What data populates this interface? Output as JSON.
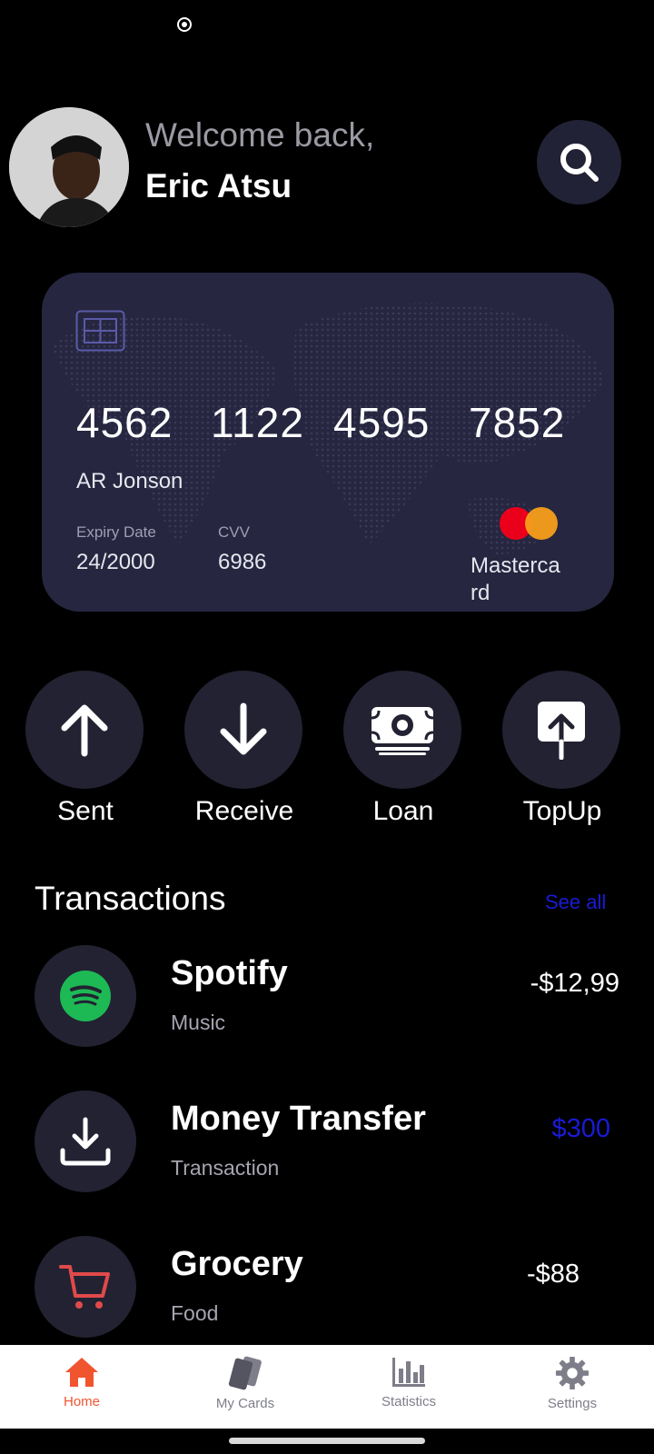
{
  "header": {
    "welcome": "Welcome back,",
    "username": "Eric Atsu"
  },
  "card": {
    "number_groups": [
      "4562",
      "1122",
      "4595",
      "7852"
    ],
    "holder": "AR Jonson",
    "expiry_label": "Expiry Date",
    "expiry_value": "24/2000",
    "cvv_label": "CVV",
    "cvv_value": "6986",
    "brand": "Mastercard",
    "colors": {
      "background": "#262640",
      "mc_red": "#eb001b",
      "mc_orange": "#f79e1b"
    }
  },
  "actions": [
    {
      "label": "Sent",
      "icon": "arrow-up-icon"
    },
    {
      "label": "Receive",
      "icon": "arrow-down-icon"
    },
    {
      "label": "Loan",
      "icon": "money-bill-icon"
    },
    {
      "label": "TopUp",
      "icon": "upload-icon"
    }
  ],
  "transactions": {
    "title": "Transactions",
    "see_all": "See all",
    "items": [
      {
        "name": "Spotify",
        "category": "Music",
        "amount": "-$12,99",
        "icon": "spotify-icon",
        "amount_color": "#ffffff"
      },
      {
        "name": "Money Transfer",
        "category": "Transaction",
        "amount": "$300",
        "icon": "download-icon",
        "amount_color": "#1a1ad6"
      },
      {
        "name": "Grocery",
        "category": "Food",
        "amount": "-$88",
        "icon": "cart-icon",
        "amount_color": "#ffffff"
      }
    ]
  },
  "bottom_nav": {
    "items": [
      {
        "label": "Home",
        "icon": "home-icon",
        "active": true
      },
      {
        "label": "My Cards",
        "icon": "cards-icon",
        "active": false
      },
      {
        "label": "Statistics",
        "icon": "bar-chart-icon",
        "active": false
      },
      {
        "label": "Settings",
        "icon": "gear-icon",
        "active": false
      }
    ],
    "active_color": "#f0552f"
  }
}
